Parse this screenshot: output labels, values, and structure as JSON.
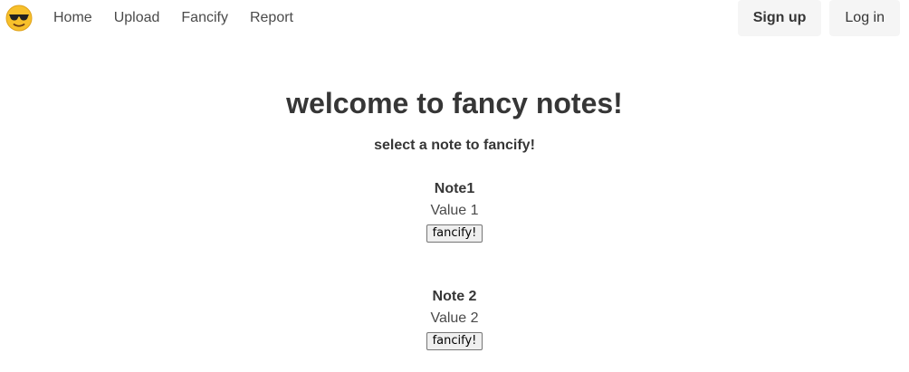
{
  "nav": {
    "logo_icon": "sunglasses-emoji-icon",
    "links": [
      "Home",
      "Upload",
      "Fancify",
      "Report"
    ],
    "signup_label": "Sign up",
    "login_label": "Log in"
  },
  "main": {
    "title": "welcome to fancy notes!",
    "subtitle": "select a note to fancify!",
    "notes": [
      {
        "title": "Note1",
        "value": "Value 1",
        "button": "fancify!"
      },
      {
        "title": "Note 2",
        "value": "Value 2",
        "button": "fancify!"
      }
    ]
  },
  "colors": {
    "text_dark": "#363636",
    "text_nav": "#4a4a4a",
    "button_light": "#f5f5f5",
    "emoji_yellow": "#f7c02b"
  }
}
